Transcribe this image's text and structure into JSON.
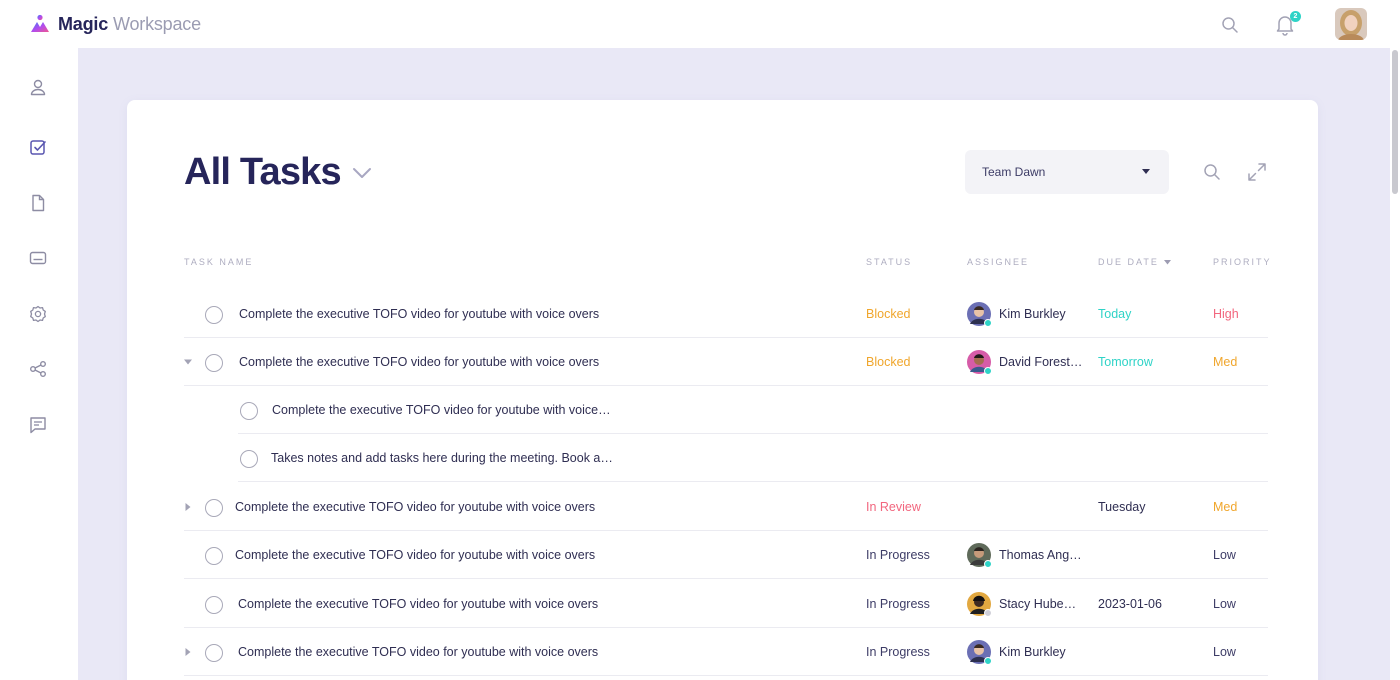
{
  "app": {
    "brand_strong": "Magic",
    "brand_light": "Workspace",
    "notification_count": "2"
  },
  "page": {
    "title": "All Tasks",
    "team_select": "Team Dawn"
  },
  "table": {
    "columns": {
      "task_name": "TASK NAME",
      "status": "STATUS",
      "assignee": "ASSIGNEE",
      "due_date": "DUE DATE",
      "priority": "PRIORITY"
    },
    "rows": [
      {
        "task": "Complete the executive TOFO video for youtube with voice overs",
        "status": "Blocked",
        "assignee": "Kim Burkley",
        "due": "Today",
        "priority": "High"
      },
      {
        "task": "Complete the executive TOFO video for youtube with voice overs",
        "status": "Blocked",
        "assignee": "David Forest…",
        "due": "Tomorrow",
        "priority": "Med"
      },
      {
        "task": "Complete the executive TOFO video for youtube with voice…"
      },
      {
        "task": "Takes notes and add tasks here during the meeting. Book a…"
      },
      {
        "task": "Complete the executive TOFO video for youtube with voice overs",
        "status": "In Review",
        "due": "Tuesday",
        "priority": "Med"
      },
      {
        "task": "Complete the executive TOFO video for youtube with voice overs",
        "status": "In Progress",
        "assignee": "Thomas Ang…",
        "priority": "Low"
      },
      {
        "task": "Complete the executive TOFO video for youtube with voice overs",
        "status": "In Progress",
        "assignee": "Stacy Hube…",
        "due": "2023-01-06",
        "priority": "Low"
      },
      {
        "task": "Complete the executive TOFO video for youtube with voice overs",
        "status": "In Progress",
        "assignee": "Kim Burkley",
        "priority": "Low"
      }
    ]
  },
  "colors": {
    "accent": "#26255a",
    "blocked": "#f0a62c",
    "in_review": "#f2667e",
    "in_progress": "#3d3c66",
    "due_highlight": "#2fd3c7",
    "priority_high": "#f2667e",
    "priority_med": "#f0a62c",
    "priority_low": "#3d3c66",
    "online_dot": "#2fd3c7"
  },
  "icons": {
    "sidebar": [
      "user-icon",
      "task-check-icon",
      "document-icon",
      "card-icon",
      "settings-gear-icon",
      "share-icon",
      "chat-icon"
    ]
  }
}
